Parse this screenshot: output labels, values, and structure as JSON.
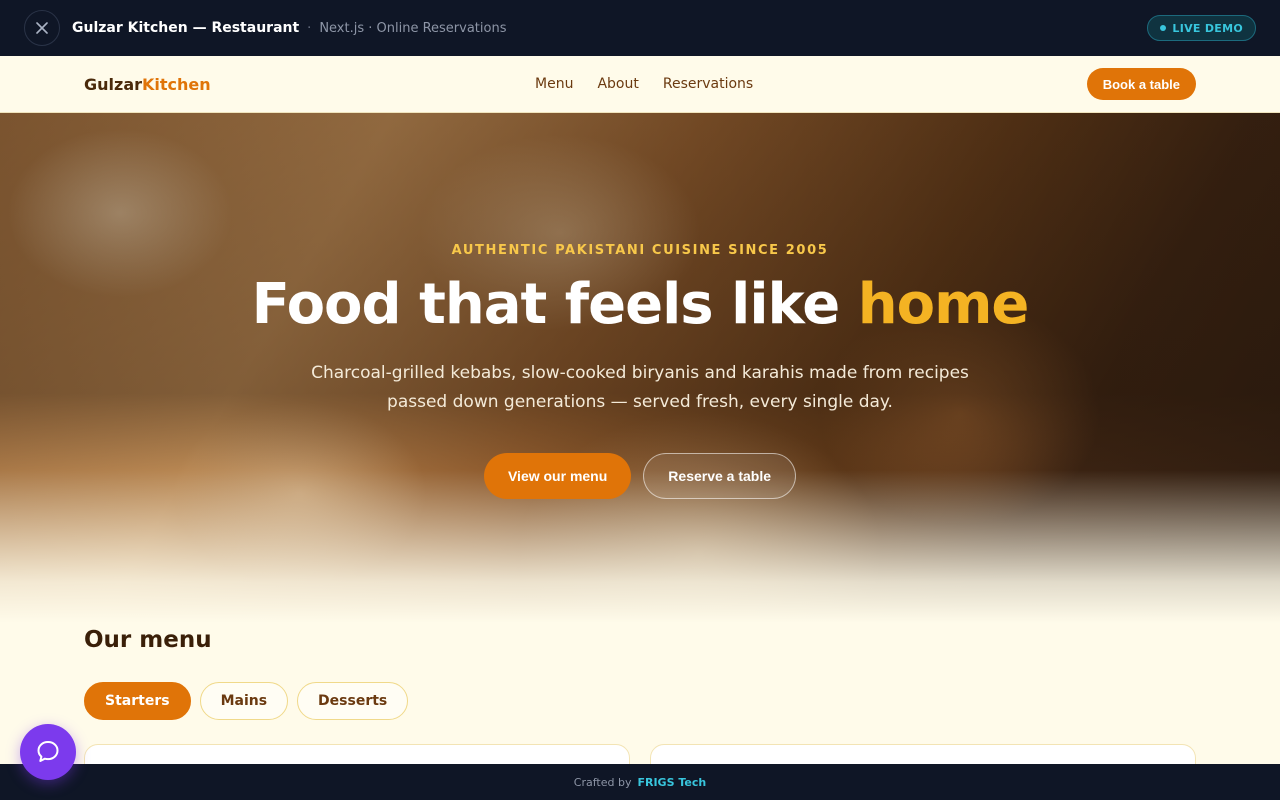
{
  "demo_bar": {
    "close_icon": "close-icon",
    "title": "Gulzar Kitchen — Restaurant",
    "separator": "·",
    "subtitle": "Next.js · Online Reservations",
    "badge": "LIVE DEMO"
  },
  "nav": {
    "logo_part1": "Gulzar",
    "logo_part2": "Kitchen",
    "links": [
      "Menu",
      "About",
      "Reservations"
    ],
    "cta": "Book a table"
  },
  "hero": {
    "eyebrow": "AUTHENTIC PAKISTANI CUISINE SINCE 2005",
    "title_main": "Food that feels like ",
    "title_highlight": "home",
    "description": "Charcoal-grilled kebabs, slow-cooked biryanis and karahis made from recipes passed down generations — served fresh, every single day.",
    "primary_button": "View our menu",
    "secondary_button": "Reserve a table"
  },
  "menu": {
    "title": "Our menu",
    "tabs": [
      "Starters",
      "Mains",
      "Desserts"
    ],
    "active_tab": "Starters"
  },
  "footer": {
    "prefix": "Crafted by",
    "brand": "FRIGS Tech"
  },
  "colors": {
    "accent": "#e07408",
    "highlight": "#f4b323",
    "dark_bar": "#0f1626",
    "chat": "#7c3aed"
  }
}
